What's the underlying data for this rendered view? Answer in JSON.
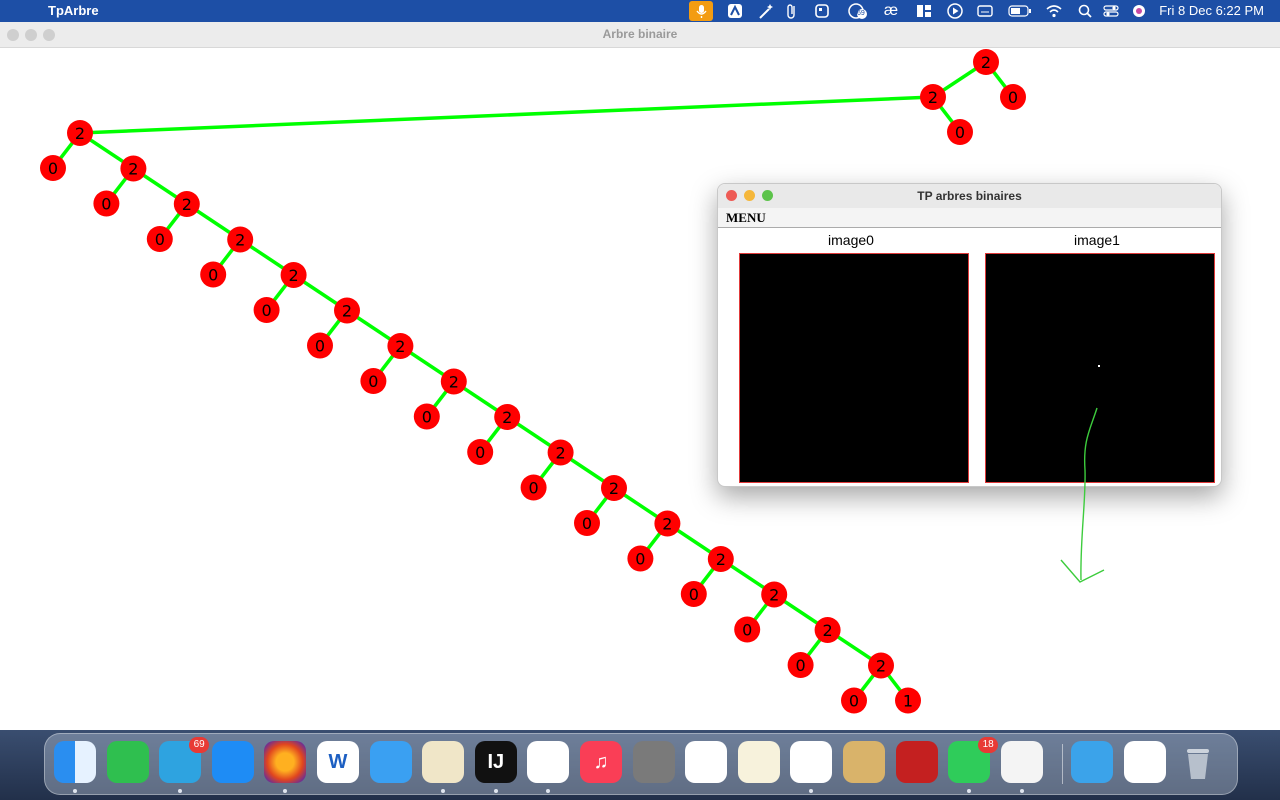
{
  "menubar": {
    "app_name": "TpArbre",
    "clock": "Fri 8 Dec  6:22 PM",
    "badge_count": "69",
    "icons": [
      "dictation-icon",
      "artboard-icon",
      "magic-wand-icon",
      "paperclip-icon",
      "square-app-icon",
      "notification-badge-icon",
      "ae-icon",
      "layout-icon",
      "play-icon",
      "keyboard-icon",
      "battery-icon",
      "wifi-icon",
      "search-icon",
      "control-center-icon",
      "siri-icon"
    ],
    "icon_glyphs": {
      "ae": "æ"
    }
  },
  "main_window": {
    "title": "Arbre binaire",
    "node_color": "#ff0000",
    "edge_color": "#00ff00",
    "tree": {
      "top_chain": [
        {
          "label": "2",
          "children": [
            "0"
          ]
        },
        {
          "label": "2",
          "children": [
            "0"
          ]
        }
      ],
      "main_chain_labels": [
        "2",
        "2",
        "2",
        "2",
        "2",
        "2",
        "2",
        "2",
        "2",
        "2",
        "2",
        "2",
        "2",
        "2",
        "2",
        "2"
      ],
      "main_chain_left_children": [
        "0",
        "0",
        "0",
        "0",
        "0",
        "0",
        "0",
        "0",
        "0",
        "0",
        "0",
        "0",
        "0",
        "0",
        "0",
        "0"
      ],
      "last_right_leaf": "1"
    }
  },
  "tp_window": {
    "title": "TP arbres binaires",
    "menu": "MENU",
    "image0_label": "image0",
    "image1_label": "image1",
    "frame_color": "#e03a3a"
  },
  "dock": {
    "apps": [
      {
        "name": "finder",
        "label": "",
        "badge": ""
      },
      {
        "name": "facetime",
        "label": "",
        "badge": ""
      },
      {
        "name": "telegram",
        "label": "",
        "badge": "69"
      },
      {
        "name": "app-store",
        "label": "",
        "badge": ""
      },
      {
        "name": "firefox",
        "label": "",
        "badge": ""
      },
      {
        "name": "word",
        "label": "W",
        "badge": ""
      },
      {
        "name": "mail",
        "label": "",
        "badge": ""
      },
      {
        "name": "python-launcher",
        "label": "",
        "badge": ""
      },
      {
        "name": "intellij",
        "label": "IJ",
        "badge": ""
      },
      {
        "name": "vscode",
        "label": "",
        "badge": ""
      },
      {
        "name": "music",
        "label": "♫",
        "badge": ""
      },
      {
        "name": "system-settings",
        "label": "",
        "badge": ""
      },
      {
        "name": "photos",
        "label": "",
        "badge": ""
      },
      {
        "name": "notes",
        "label": "",
        "badge": ""
      },
      {
        "name": "brave",
        "label": "",
        "badge": ""
      },
      {
        "name": "archive-utility",
        "label": "",
        "badge": ""
      },
      {
        "name": "acrobat",
        "label": "",
        "badge": ""
      },
      {
        "name": "whatsapp",
        "label": "",
        "badge": "18"
      },
      {
        "name": "java",
        "label": "",
        "badge": ""
      },
      {
        "name": "downloads-folder",
        "label": "",
        "badge": ""
      },
      {
        "name": "document-preview",
        "label": "",
        "badge": ""
      },
      {
        "name": "trash",
        "label": "",
        "badge": ""
      }
    ]
  }
}
